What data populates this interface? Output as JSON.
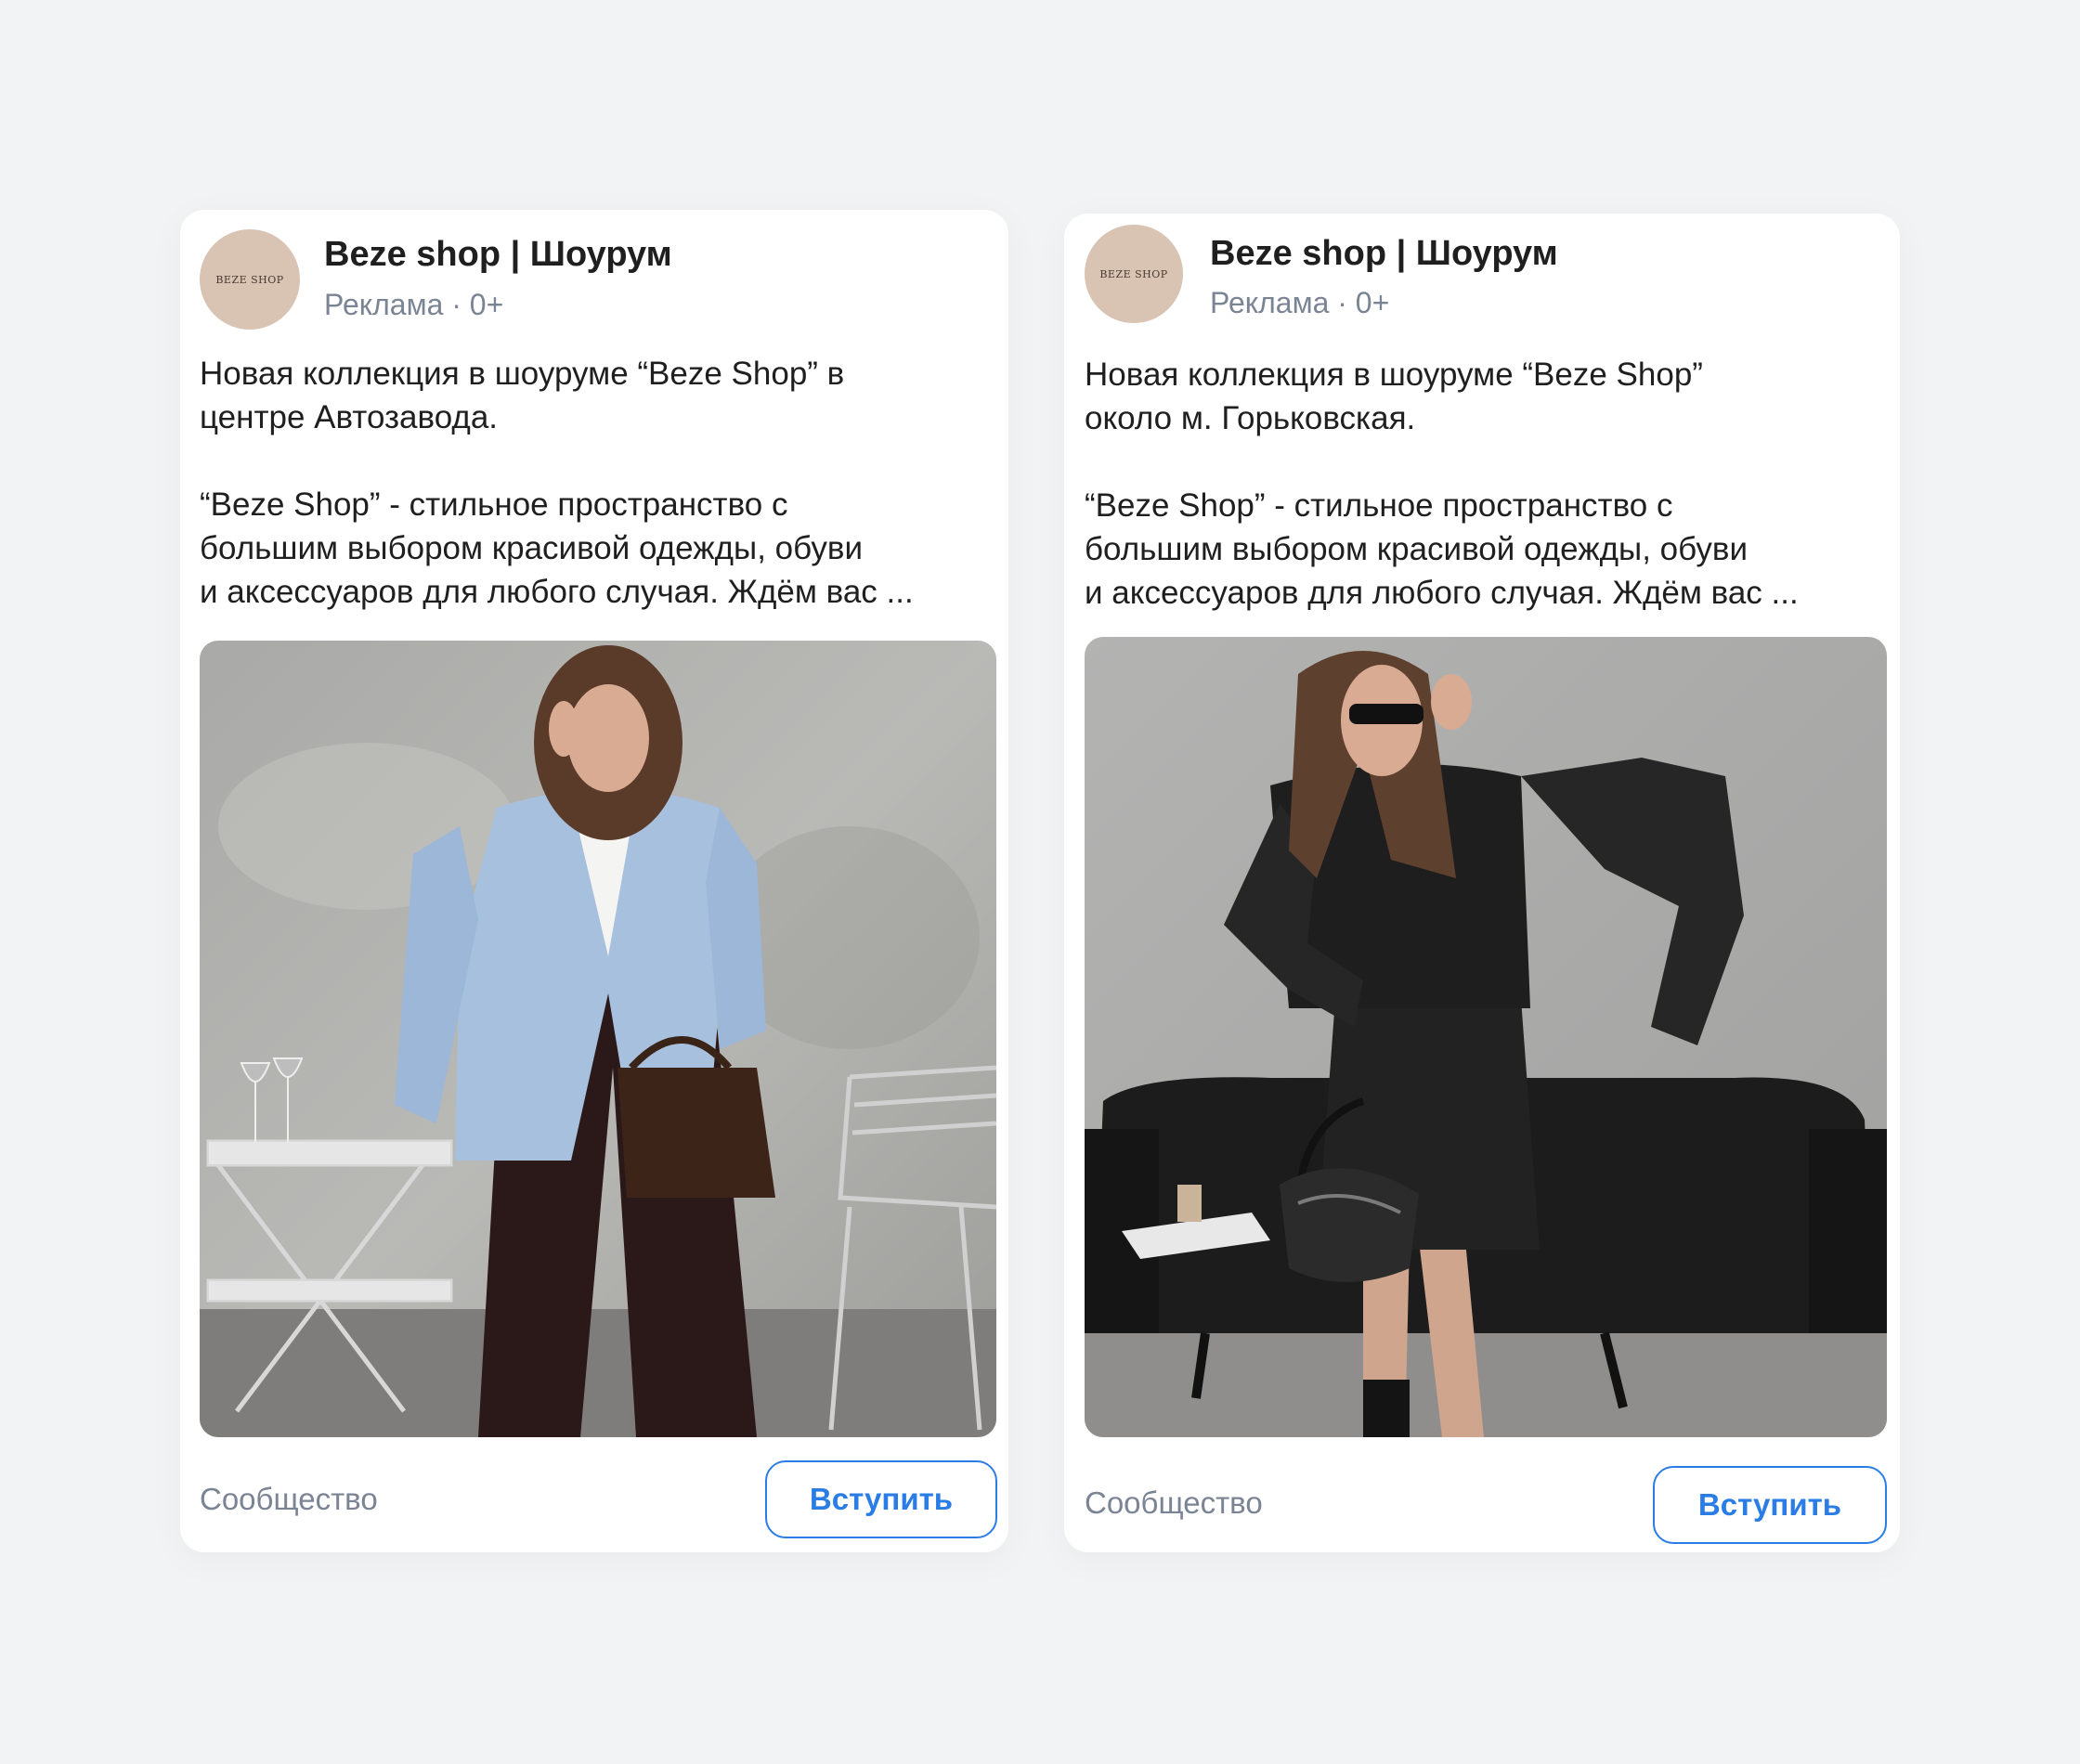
{
  "posts": [
    {
      "author": "Beze shop | Шоурум",
      "avatar_text": "BEZE SHOP",
      "meta": "Реклама · 0+",
      "text_lines_1": [
        "Новая коллекция в шоуруме “Beze Shop” в",
        "центре Автозавода."
      ],
      "text_lines_2": [
        "“Beze Shop” - стильное пространство с",
        "большим выбором красивой одежды, обуви",
        "и аксессуаров для любого случая. Ждём вас ..."
      ],
      "footer_label": "Сообщество",
      "button_label": "Вступить"
    },
    {
      "author": "Beze shop | Шоурум",
      "avatar_text": "BEZE SHOP",
      "meta": "Реклама · 0+",
      "text_lines_1": [
        "Новая коллекция в шоуруме “Beze Shop”",
        "около м. Горьковская."
      ],
      "text_lines_2": [
        "“Beze Shop” - стильное пространство с",
        "большим выбором красивой одежды, обуви",
        "и аксессуаров для любого случая. Ждём вас ..."
      ],
      "footer_label": "Сообщество",
      "button_label": "Вступить"
    }
  ],
  "colors": {
    "background": "#f2f3f5",
    "card": "#ffffff",
    "accent": "#2b7de6",
    "secondary_text": "#7b8494",
    "avatar": "#d9c3b3"
  }
}
